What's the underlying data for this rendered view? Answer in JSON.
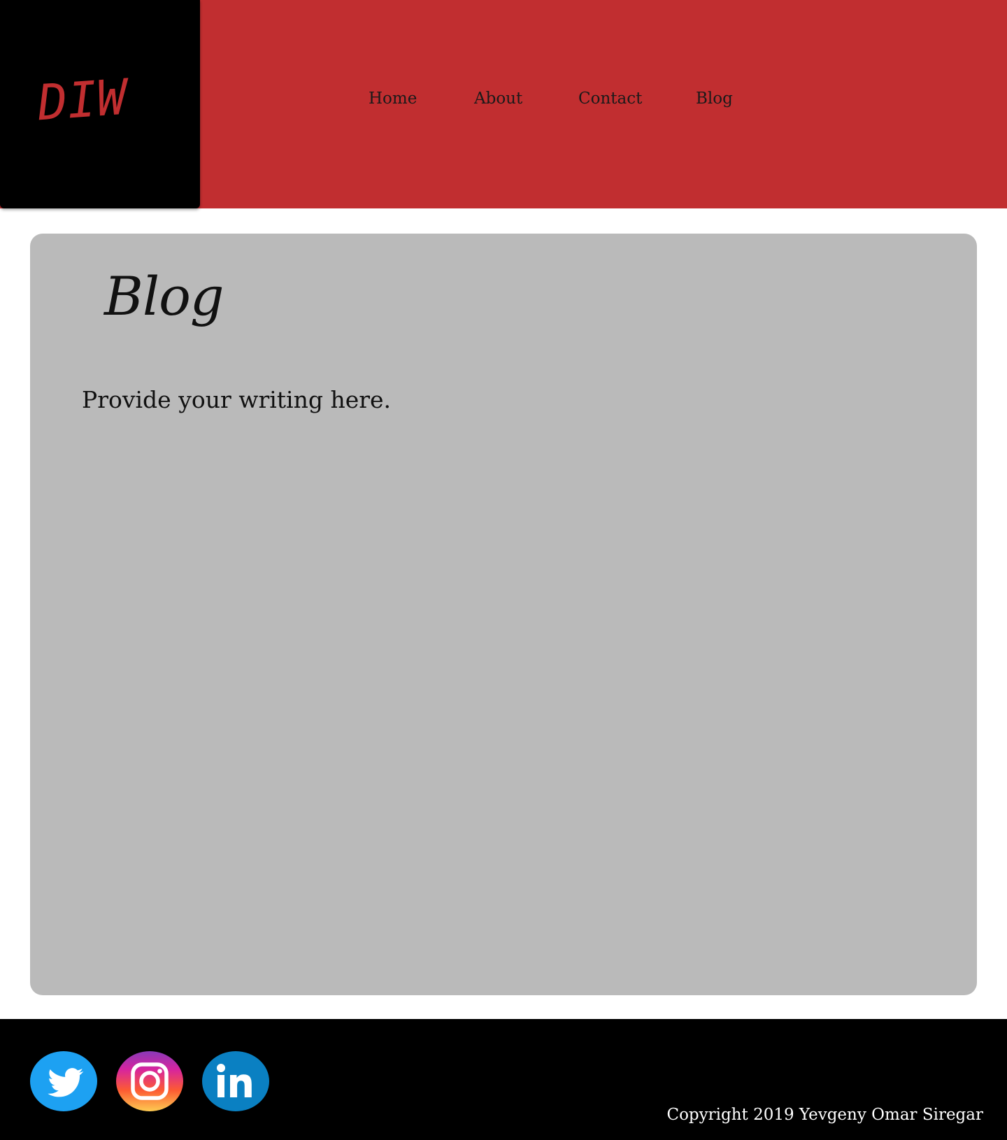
{
  "brand": {
    "logo_text": "DIW",
    "logo_color": "#c12e30"
  },
  "header": {
    "background": "#c12e30"
  },
  "nav": {
    "items": [
      {
        "label": "Home"
      },
      {
        "label": "About"
      },
      {
        "label": "Contact"
      },
      {
        "label": "Blog"
      }
    ]
  },
  "main": {
    "title": "Blog",
    "body": "Provide your writing here.",
    "card_color": "#bababa"
  },
  "footer": {
    "social": [
      {
        "name": "twitter",
        "icon": "twitter-icon",
        "color": "#1da1f2"
      },
      {
        "name": "instagram",
        "icon": "instagram-icon",
        "color": "#d6249f"
      },
      {
        "name": "linkedin",
        "icon": "linkedin-icon",
        "color": "#0a80c2"
      }
    ],
    "copyright": "Copyright 2019 Yevgeny Omar Siregar"
  }
}
